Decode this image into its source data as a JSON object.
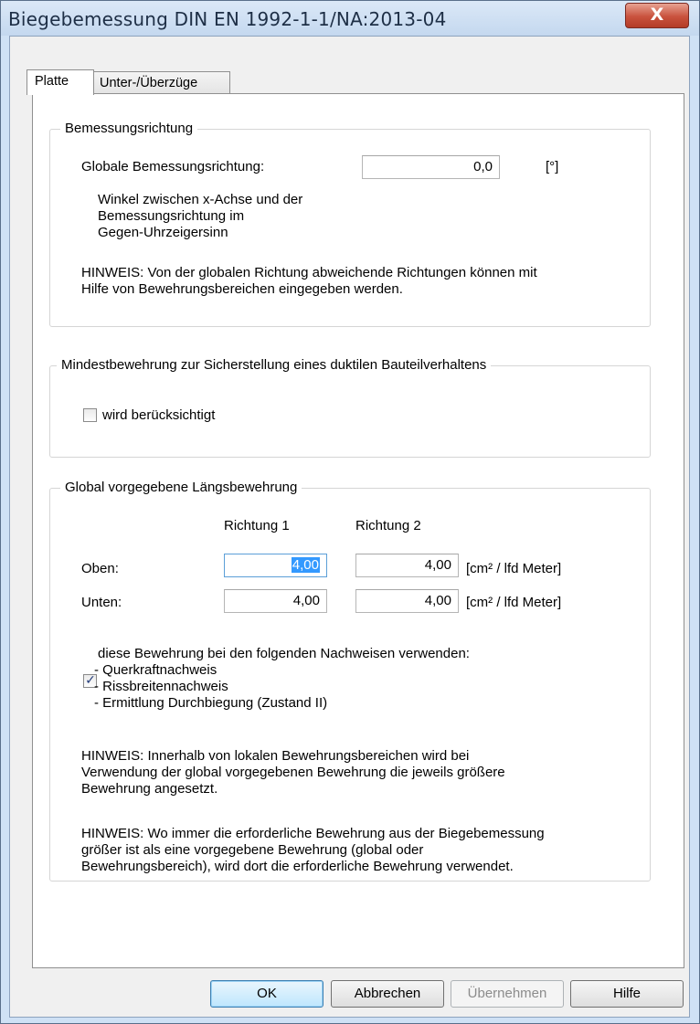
{
  "window": {
    "title": "Biegebemessung DIN EN 1992-1-1/NA:2013-04",
    "close_glyph": "X"
  },
  "tabs": [
    {
      "label": "Platte",
      "active": true
    },
    {
      "label": "Unter-/Überzüge",
      "active": false
    }
  ],
  "bemessungsrichtung": {
    "title": "Bemessungsrichtung",
    "global_label": "Globale Bemessungsrichtung:",
    "global_value": "0,0",
    "unit": "[°]",
    "desc_line1": "Winkel zwischen x-Achse und der",
    "desc_line2": "Bemessungsrichtung im",
    "desc_line3": "Gegen-Uhrzeigersinn",
    "hint_line1": "HINWEIS: Von der globalen Richtung abweichende Richtungen können mit",
    "hint_line2": "Hilfe von Bewehrungsbereichen eingegeben werden."
  },
  "mindestbewehrung": {
    "title": "Mindestbewehrung zur Sicherstellung eines duktilen Bauteilverhaltens",
    "checkbox_label": "wird berücksichtigt",
    "checked": false
  },
  "laengsbewehrung": {
    "title": "Global vorgegebene Längsbewehrung",
    "col1": "Richtung 1",
    "col2": "Richtung 2",
    "oben_label": "Oben:",
    "oben_r1": "4,00",
    "oben_r2": "4,00",
    "unten_label": "Unten:",
    "unten_r1": "4,00",
    "unten_r2": "4,00",
    "unit": "[cm² / lfd Meter]",
    "use_checked": true,
    "use_line1": "diese Bewehrung bei den folgenden Nachweisen verwenden:",
    "use_line2": "- Querkraftnachweis",
    "use_line3": "- Rissbreitennachweis",
    "use_line4": "- Ermittlung Durchbiegung (Zustand II)",
    "hint1_line1": "HINWEIS: Innerhalb von lokalen Bewehrungsbereichen wird bei",
    "hint1_line2": "Verwendung der global vorgegebenen Bewehrung die jeweils größere",
    "hint1_line3": "Bewehrung angesetzt.",
    "hint2_line1": "HINWEIS: Wo immer die erforderliche Bewehrung aus der Biegebemessung",
    "hint2_line2": "größer ist als eine vorgegebene Bewehrung (global oder",
    "hint2_line3": "Bewehrungsbereich), wird dort die erforderliche Bewehrung verwendet."
  },
  "buttons": {
    "ok": "OK",
    "cancel": "Abbrechen",
    "apply": "Übernehmen",
    "help": "Hilfe"
  }
}
